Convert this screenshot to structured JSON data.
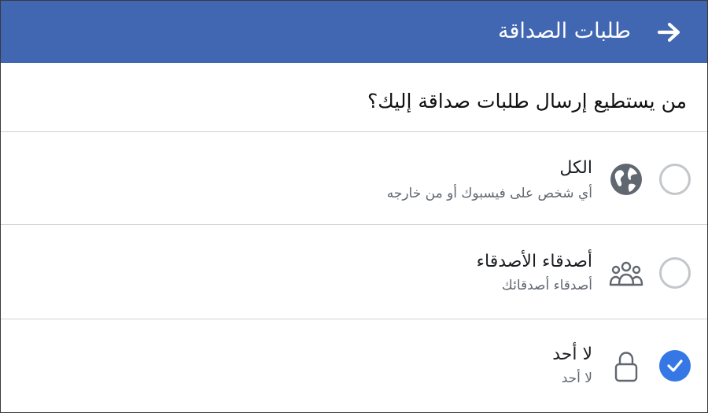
{
  "header": {
    "title": "طلبات الصداقة",
    "back_icon": "arrow-right-icon",
    "background": "#4267b2"
  },
  "question": {
    "text": "من يستطيع إرسال طلبات صداقة إليك؟"
  },
  "options": [
    {
      "label": "الكل",
      "description": "أي شخص على فيسبوك أو من خارجه",
      "icon": "globe-icon",
      "selected": false
    },
    {
      "label": "أصدقاء الأصدقاء",
      "description": "أصدقاء أصدقائك",
      "icon": "friends-group-icon",
      "selected": false
    },
    {
      "label": "لا أحد",
      "description": "لا أحد",
      "icon": "lock-icon",
      "selected": true
    }
  ],
  "colors": {
    "accent": "#3578e5",
    "divider": "#cfd1d5",
    "secondary_text": "#606770"
  }
}
